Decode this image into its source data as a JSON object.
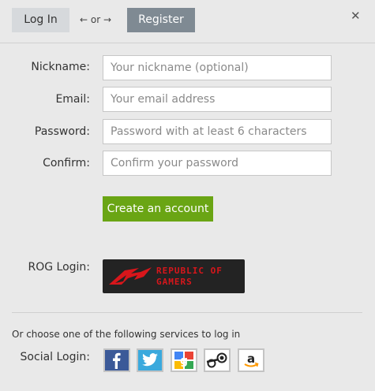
{
  "tabs": {
    "login": "Log In",
    "or": "← or →",
    "register": "Register"
  },
  "form": {
    "nickname": {
      "label": "Nickname:",
      "placeholder": "Your nickname (optional)"
    },
    "email": {
      "label": "Email:",
      "placeholder": "Your email address"
    },
    "password": {
      "label": "Password:",
      "placeholder": "Password with at least 6 characters"
    },
    "confirm": {
      "label": "Confirm:",
      "placeholder": "Confirm your password"
    },
    "submit": "Create an account"
  },
  "rog": {
    "label": "ROG Login:",
    "line1": "REPUBLIC OF",
    "line2": "GAMERS"
  },
  "social": {
    "prompt": "Or choose one of the following services to log in",
    "label": "Social Login:",
    "services": [
      "facebook-icon",
      "twitter-icon",
      "google-icon",
      "steam-icon",
      "amazon-icon"
    ]
  },
  "colors": {
    "accent": "#6aa514",
    "register_tab": "#7f8a93",
    "rog_red": "#d8161b"
  }
}
